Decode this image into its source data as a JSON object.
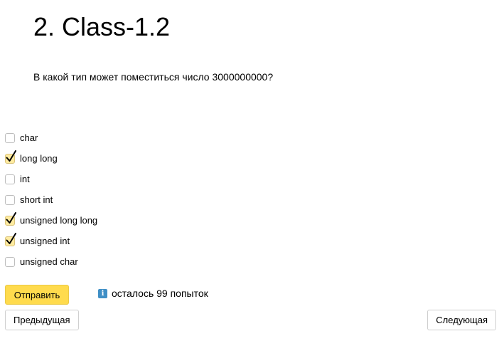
{
  "page": {
    "title": "2. Class-1.2",
    "question": "В какой тип может поместиться число 3000000000?"
  },
  "options": [
    {
      "label": "char",
      "checked": false
    },
    {
      "label": "long long",
      "checked": true
    },
    {
      "label": "int",
      "checked": false
    },
    {
      "label": "short int",
      "checked": false
    },
    {
      "label": "unsigned long long",
      "checked": true
    },
    {
      "label": "unsigned int",
      "checked": true
    },
    {
      "label": "unsigned char",
      "checked": false
    }
  ],
  "actions": {
    "submit_label": "Отправить",
    "attempts_text": "осталось 99 попыток",
    "info_icon": "i",
    "prev_label": "Предыдущая",
    "next_label": "Следующая"
  },
  "colors": {
    "submit_button": "#ffdb4d",
    "checked_fill": "#ffeba0",
    "info_icon": "#3f8fc6"
  }
}
